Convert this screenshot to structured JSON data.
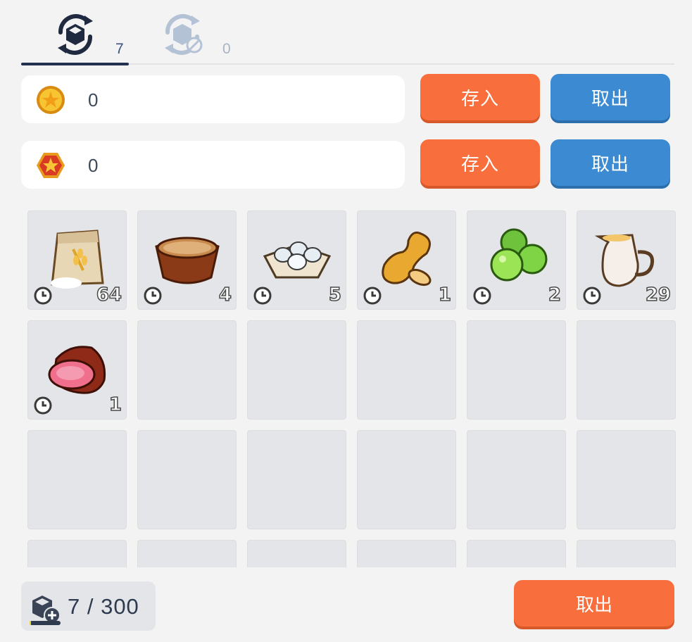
{
  "tabs": [
    {
      "icon": "storage-sync-icon",
      "count": "7",
      "active": true
    },
    {
      "icon": "storage-sync-disabled-icon",
      "count": "0",
      "active": false
    }
  ],
  "currencies": [
    {
      "icon": "gold-coin-icon",
      "value": "0",
      "deposit_label": "存入",
      "withdraw_label": "取出"
    },
    {
      "icon": "red-star-hex-icon",
      "value": "0",
      "deposit_label": "存入",
      "withdraw_label": "取出"
    }
  ],
  "items": [
    {
      "name": "flour-sack",
      "qty": "64"
    },
    {
      "name": "grain-bowl",
      "qty": "4"
    },
    {
      "name": "egg-tray",
      "qty": "5"
    },
    {
      "name": "peanut",
      "qty": "1"
    },
    {
      "name": "green-apples",
      "qty": "2"
    },
    {
      "name": "milk-pitcher",
      "qty": "29"
    },
    {
      "name": "ham",
      "qty": "1"
    }
  ],
  "capacity": {
    "text": "7 / 300",
    "fill": 0.023
  },
  "footer": {
    "withdraw_label": "取出"
  },
  "colors": {
    "deposit": "#f86e3c",
    "withdraw": "#3c8bd2",
    "slot": "#e4e5e8"
  }
}
